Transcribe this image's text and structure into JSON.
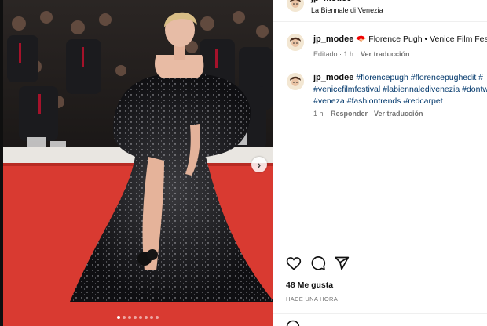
{
  "header": {
    "username": "jp_modee",
    "location": "La Biennale di Venezia"
  },
  "caption": {
    "username": "jp_modee",
    "emoji": "🪭",
    "text": "Florence Pugh • Venice Film Festi",
    "edited": "Editado · 1 h",
    "translate": "Ver traducción"
  },
  "comment": {
    "username": "jp_modee",
    "line1": "#florencepugh #florencepughedit #",
    "line2": "#venicefilmfestival #labiennaledivenezia #dontw",
    "line3": "#veneza #fashiontrends #redcarpet",
    "time": "1 h",
    "reply": "Responder",
    "translate": "Ver traducción"
  },
  "actions": {
    "likes": "48 Me gusta",
    "posted": "HACE UNA HORA"
  },
  "carousel": {
    "total_dots": 8,
    "active_dot": 0
  },
  "colors": {
    "carpet": "#d93a31",
    "link": "#00376b",
    "secondary": "#737373"
  }
}
